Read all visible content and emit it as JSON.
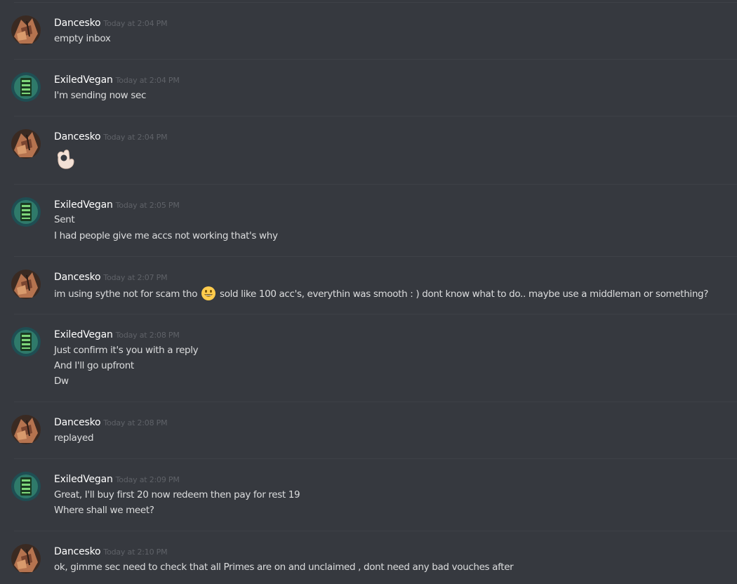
{
  "messages": [
    {
      "author": "Dancesko",
      "time": "Today at 2:04 PM",
      "lines": [
        "empty inbox"
      ]
    },
    {
      "author": "ExiledVegan",
      "time": "Today at 2:04 PM",
      "lines": [
        "I'm sending now sec"
      ]
    },
    {
      "author": "Dancesko",
      "time": "Today at 2:04 PM",
      "emoji": "ok-hand-emoji"
    },
    {
      "author": "ExiledVegan",
      "time": "Today at 2:05 PM",
      "lines": [
        "Sent",
        "I had people give me accs not working that's why"
      ]
    },
    {
      "author": "Dancesko",
      "time": "Today at 2:07 PM",
      "line_parts": {
        "before": "im using sythe not for scam tho",
        "emoji": "smiley-emoji",
        "after": "sold like 100 acc's, everythin was smooth : ) dont know what to do.. maybe use a middleman or something?"
      }
    },
    {
      "author": "ExiledVegan",
      "time": "Today at 2:08 PM",
      "lines": [
        "Just confirm it's you with a reply",
        "And I'll go upfront",
        "Dw"
      ]
    },
    {
      "author": "Dancesko",
      "time": "Today at 2:08 PM",
      "lines": [
        "replayed"
      ]
    },
    {
      "author": "ExiledVegan",
      "time": "Today at 2:09 PM",
      "lines": [
        "Great, I'll buy first 20 now redeem then pay for rest 19",
        "Where shall we meet?"
      ]
    },
    {
      "author": "Dancesko",
      "time": "Today at 2:10 PM",
      "lines": [
        "ok, gimme sec need to check that all Primes are on and unclaimed , dont need any bad vouches after"
      ]
    }
  ],
  "colors": {
    "background": "#36393f",
    "username": "#ffffff",
    "timestamp": "#5f6268",
    "text": "#dcddde"
  }
}
